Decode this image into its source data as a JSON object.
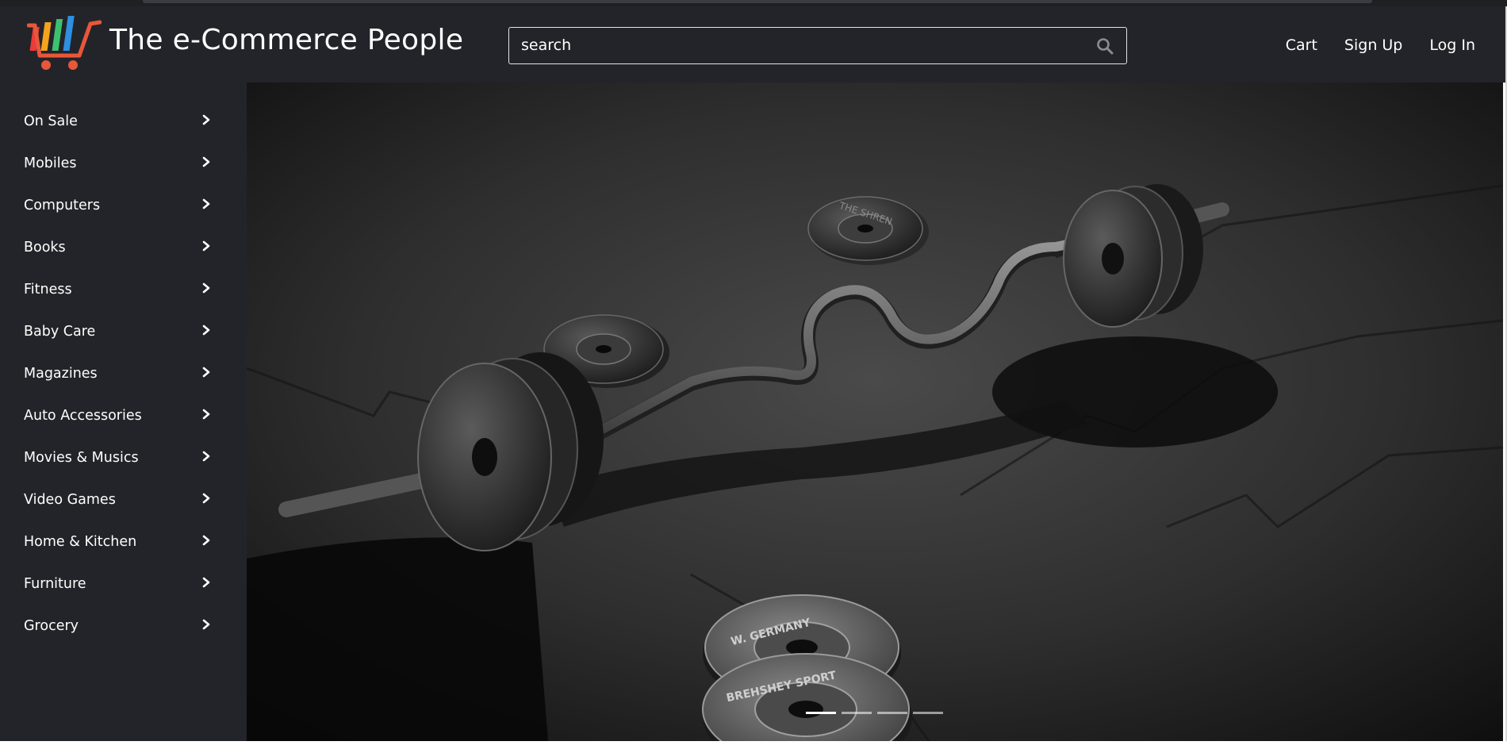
{
  "header": {
    "brand": "The e-Commerce People",
    "search": {
      "placeholder": "search"
    },
    "links": [
      {
        "label": "Cart"
      },
      {
        "label": "Sign Up"
      },
      {
        "label": "Log In"
      }
    ]
  },
  "sidebar": {
    "items": [
      {
        "label": "On Sale"
      },
      {
        "label": "Mobiles"
      },
      {
        "label": "Computers"
      },
      {
        "label": "Books"
      },
      {
        "label": "Fitness"
      },
      {
        "label": "Baby Care"
      },
      {
        "label": "Magazines"
      },
      {
        "label": "Auto Accessories"
      },
      {
        "label": "Movies & Musics"
      },
      {
        "label": "Video Games"
      },
      {
        "label": "Home & Kitchen"
      },
      {
        "label": "Furniture"
      },
      {
        "label": "Grocery"
      }
    ]
  },
  "carousel": {
    "slide_count": 4,
    "active_index": 0,
    "plate_text": [
      "THE SHREN",
      "BREHSHEY SPORT",
      "W. GERMANY"
    ]
  },
  "colors": {
    "navbar": "#232429",
    "sidebar": "#232429",
    "logo_cart": "#e8573a"
  }
}
